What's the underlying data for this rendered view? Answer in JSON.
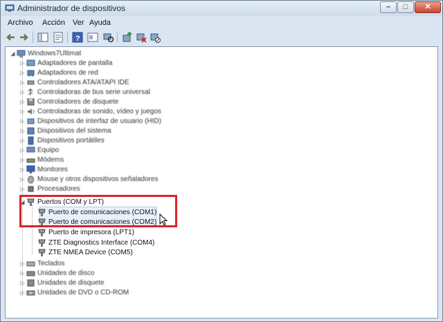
{
  "window": {
    "title": "Administrador de dispositivos"
  },
  "titlebar_buttons": {
    "minimize": "–",
    "maximize": "□",
    "close": "✕"
  },
  "menu": [
    "Archivo",
    "Acción",
    "Ver",
    "Ayuda"
  ],
  "toolbar": [
    "back-icon",
    "forward-icon",
    "show-hide-console-tree-icon",
    "properties-icon",
    "help-icon",
    "details-icon",
    "scan-hardware-icon",
    "update-driver-icon",
    "uninstall-icon",
    "disable-icon"
  ],
  "tree": {
    "root": "Windows7Ultimat",
    "categories_before": [
      "Adaptadores de pantalla",
      "Adaptadores de red",
      "Controladores ATA/ATAPI IDE",
      "Controladoras de bus serie universal",
      "Controladores de disquete",
      "Controladoras de sonido, vídeo y juegos",
      "Dispositivos de interfaz de usuario (HID)",
      "Dispositivos del sistema",
      "Dispositivos portátiles",
      "Equipo",
      "Módems",
      "Monitores",
      "Mouse y otros dispositivos señaladores",
      "Procesadores"
    ],
    "ports": {
      "label": "Puertos (COM y LPT)",
      "children": [
        "Puerto de comunicaciones (COM1)",
        "Puerto de comunicaciones (COM2)",
        "Puerto de impresora (LPT1)",
        "ZTE Diagnostics Interface (COM4)",
        "ZTE NMEA Device (COM5)"
      ]
    },
    "categories_after": [
      "Teclados",
      "Unidades de disco",
      "Unidades de disquete",
      "Unidades de DVD o CD-ROM"
    ]
  },
  "colors": {
    "highlight": "#d8232a",
    "window_frame": "#dce6f2"
  }
}
